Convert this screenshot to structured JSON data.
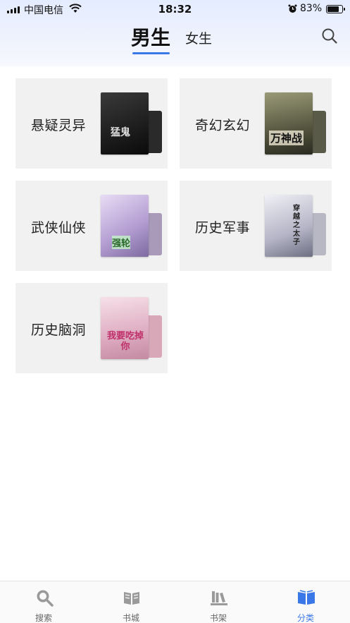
{
  "status_bar": {
    "carrier": "中国电信",
    "time": "18:32",
    "battery": "83%",
    "battery_level": 0.83
  },
  "header": {
    "tabs": [
      {
        "label": "男生",
        "active": true
      },
      {
        "label": "女生",
        "active": false
      }
    ]
  },
  "categories": [
    {
      "label": "悬疑灵异",
      "cover_text": "猛鬼",
      "cover_colors": [
        "#2b2b2b",
        "#0d0d0d"
      ]
    },
    {
      "label": "奇幻玄幻",
      "cover_text": "万神战",
      "cover_colors": [
        "#8a8a6a",
        "#3a3a30"
      ]
    },
    {
      "label": "武侠仙侠",
      "cover_text": "强轮",
      "cover_colors": [
        "#d8c6e8",
        "#8a7aa8"
      ]
    },
    {
      "label": "历史军事",
      "cover_text": "穿越之太子",
      "cover_colors": [
        "#e6e6ee",
        "#8a8a9a"
      ]
    },
    {
      "label": "历史脑洞",
      "cover_text": "我要吃掉你",
      "cover_colors": [
        "#f2d2dc",
        "#c88aa0"
      ]
    }
  ],
  "tabbar": {
    "items": [
      {
        "label": "搜索",
        "icon": "search-icon",
        "active": false
      },
      {
        "label": "书城",
        "icon": "book-icon",
        "active": false
      },
      {
        "label": "书架",
        "icon": "bookshelf-icon",
        "active": false
      },
      {
        "label": "分类",
        "icon": "category-icon",
        "active": true
      }
    ]
  },
  "colors": {
    "accent": "#3b78e7",
    "card_bg": "#f1f1f1"
  }
}
